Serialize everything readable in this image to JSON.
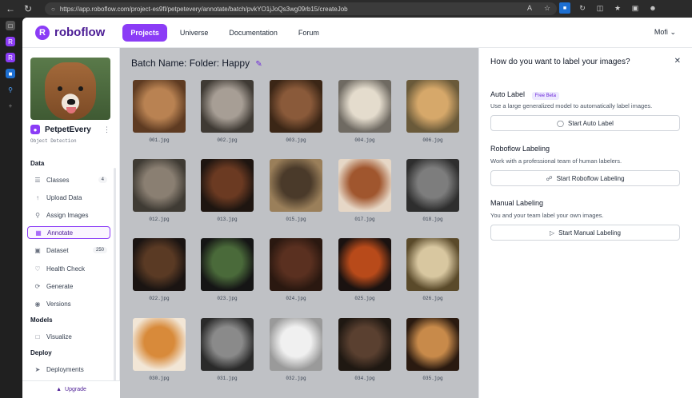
{
  "browser": {
    "url": "https://app.roboflow.com/project-es9fl/petpetevery/annotate/batch/pvkYO1jJoQs3wg09rb15/createJob"
  },
  "topnav": {
    "logo_text": "roboflow",
    "items": [
      "Projects",
      "Universe",
      "Documentation",
      "Forum"
    ],
    "user": "Mofi"
  },
  "sidebar": {
    "project_name": "PetpetEvery",
    "project_type": "Object Detection",
    "sections": {
      "data": "Data",
      "models": "Models",
      "deploy": "Deploy"
    },
    "items": [
      {
        "label": "Classes",
        "badge": "4",
        "icon": "list-icon"
      },
      {
        "label": "Upload Data",
        "badge": "",
        "icon": "upload-icon"
      },
      {
        "label": "Assign Images",
        "badge": "",
        "icon": "search-icon"
      },
      {
        "label": "Annotate",
        "badge": "",
        "icon": "annotate-icon"
      },
      {
        "label": "Dataset",
        "badge": "250",
        "icon": "dataset-icon"
      },
      {
        "label": "Health Check",
        "badge": "",
        "icon": "health-icon"
      },
      {
        "label": "Generate",
        "badge": "",
        "icon": "generate-icon"
      },
      {
        "label": "Versions",
        "badge": "",
        "icon": "versions-icon"
      },
      {
        "label": "Visualize",
        "badge": "",
        "icon": "chart-icon"
      },
      {
        "label": "Deployments",
        "badge": "",
        "icon": "deploy-icon"
      }
    ],
    "upgrade": "Upgrade"
  },
  "main": {
    "batch_title": "Batch Name: Folder: Happy",
    "images": [
      {
        "file": "001.jpg",
        "c1": "#b98252",
        "c2": "#5e3b22"
      },
      {
        "file": "002.jpg",
        "c1": "#a79e95",
        "c2": "#3f3a34"
      },
      {
        "file": "003.jpg",
        "c1": "#8a5a3a",
        "c2": "#3b2616"
      },
      {
        "file": "004.jpg",
        "c1": "#e4dccd",
        "c2": "#6f6a62"
      },
      {
        "file": "006.jpg",
        "c1": "#d6a86a",
        "c2": "#6a5a3a"
      },
      {
        "file": "012.jpg",
        "c1": "#8a7f72",
        "c2": "#3f3b34"
      },
      {
        "file": "013.jpg",
        "c1": "#6b3a22",
        "c2": "#1e1510"
      },
      {
        "file": "015.jpg",
        "c1": "#4a3a2a",
        "c2": "#9a7f5a"
      },
      {
        "file": "017.jpg",
        "c1": "#a0562e",
        "c2": "#e6d7c6"
      },
      {
        "file": "018.jpg",
        "c1": "#7d7d7d",
        "c2": "#2e2e2e"
      },
      {
        "file": "022.jpg",
        "c1": "#5a3a24",
        "c2": "#1a1412"
      },
      {
        "file": "023.jpg",
        "c1": "#4a6a3a",
        "c2": "#151515"
      },
      {
        "file": "024.jpg",
        "c1": "#5a3020",
        "c2": "#2a1810"
      },
      {
        "file": "025.jpg",
        "c1": "#b84a1a",
        "c2": "#1a1210"
      },
      {
        "file": "026.jpg",
        "c1": "#d8c7a0",
        "c2": "#5a4a2a"
      },
      {
        "file": "030.jpg",
        "c1": "#d88a3a",
        "c2": "#f2e6d6"
      },
      {
        "file": "031.jpg",
        "c1": "#8a8a8a",
        "c2": "#2a2a2a"
      },
      {
        "file": "032.jpg",
        "c1": "#f0f0f0",
        "c2": "#9a9a9a"
      },
      {
        "file": "034.jpg",
        "c1": "#5a4030",
        "c2": "#1f1812"
      },
      {
        "file": "035.jpg",
        "c1": "#c88a4a",
        "c2": "#2a1a10"
      }
    ]
  },
  "panel": {
    "title": "How do you want to label your images?",
    "auto": {
      "title": "Auto Label",
      "badge": "Free Beta",
      "desc": "Use a large generalized model to automatically label images.",
      "button": "Start Auto Label"
    },
    "roboflow": {
      "title": "Roboflow Labeling",
      "desc": "Work with a professional team of human labelers.",
      "button": "Start Roboflow Labeling"
    },
    "manual": {
      "title": "Manual Labeling",
      "desc": "You and your team label your own images.",
      "button": "Start Manual Labeling"
    }
  }
}
